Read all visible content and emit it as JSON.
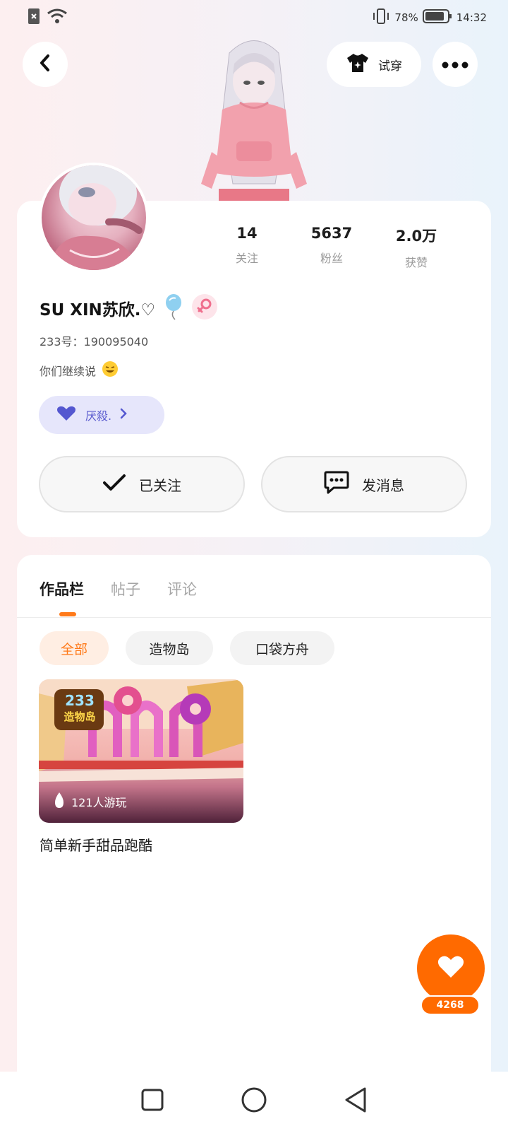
{
  "status_bar": {
    "battery": "78%",
    "time": "14:32"
  },
  "header": {
    "try_on_label": "试穿"
  },
  "profile": {
    "stats": [
      {
        "value": "14",
        "label": "关注"
      },
      {
        "value": "5637",
        "label": "粉丝"
      },
      {
        "value": "2.0万",
        "label": "获赞"
      }
    ],
    "name": "SU XIN苏欣.♡",
    "id_line": "233号：190095040",
    "signature": "你们继续说",
    "tag_label": "厌殺.",
    "follow_button": "已关注",
    "message_button": "发消息"
  },
  "tabs": [
    {
      "label": "作品栏"
    },
    {
      "label": "帖子"
    },
    {
      "label": "评论"
    }
  ],
  "filters": [
    {
      "label": "全部"
    },
    {
      "label": "造物岛"
    },
    {
      "label": "口袋方舟"
    }
  ],
  "works": [
    {
      "badge_line1": "233",
      "badge_line2": "造物岛",
      "plays": "121人游玩",
      "title": "简单新手甜品跑酷"
    }
  ],
  "like_fab": {
    "count": "4268"
  },
  "colors": {
    "accent": "#ff6a00",
    "tag_bg": "#e6e6fb",
    "tag_text": "#5b5ccf",
    "chip_active_bg": "#ffeee3",
    "chip_active_text": "#ff7a1a",
    "chip_bg": "#f3f3f3"
  },
  "icons": {
    "back": "chevron-left-icon",
    "try_on": "tshirt-icon",
    "more": "more-dots-icon",
    "gender": "female-icon",
    "tag": "heart-icon",
    "follow": "check-icon",
    "message": "chat-bubble-icon",
    "plays": "flame-icon",
    "like": "heart-icon"
  }
}
